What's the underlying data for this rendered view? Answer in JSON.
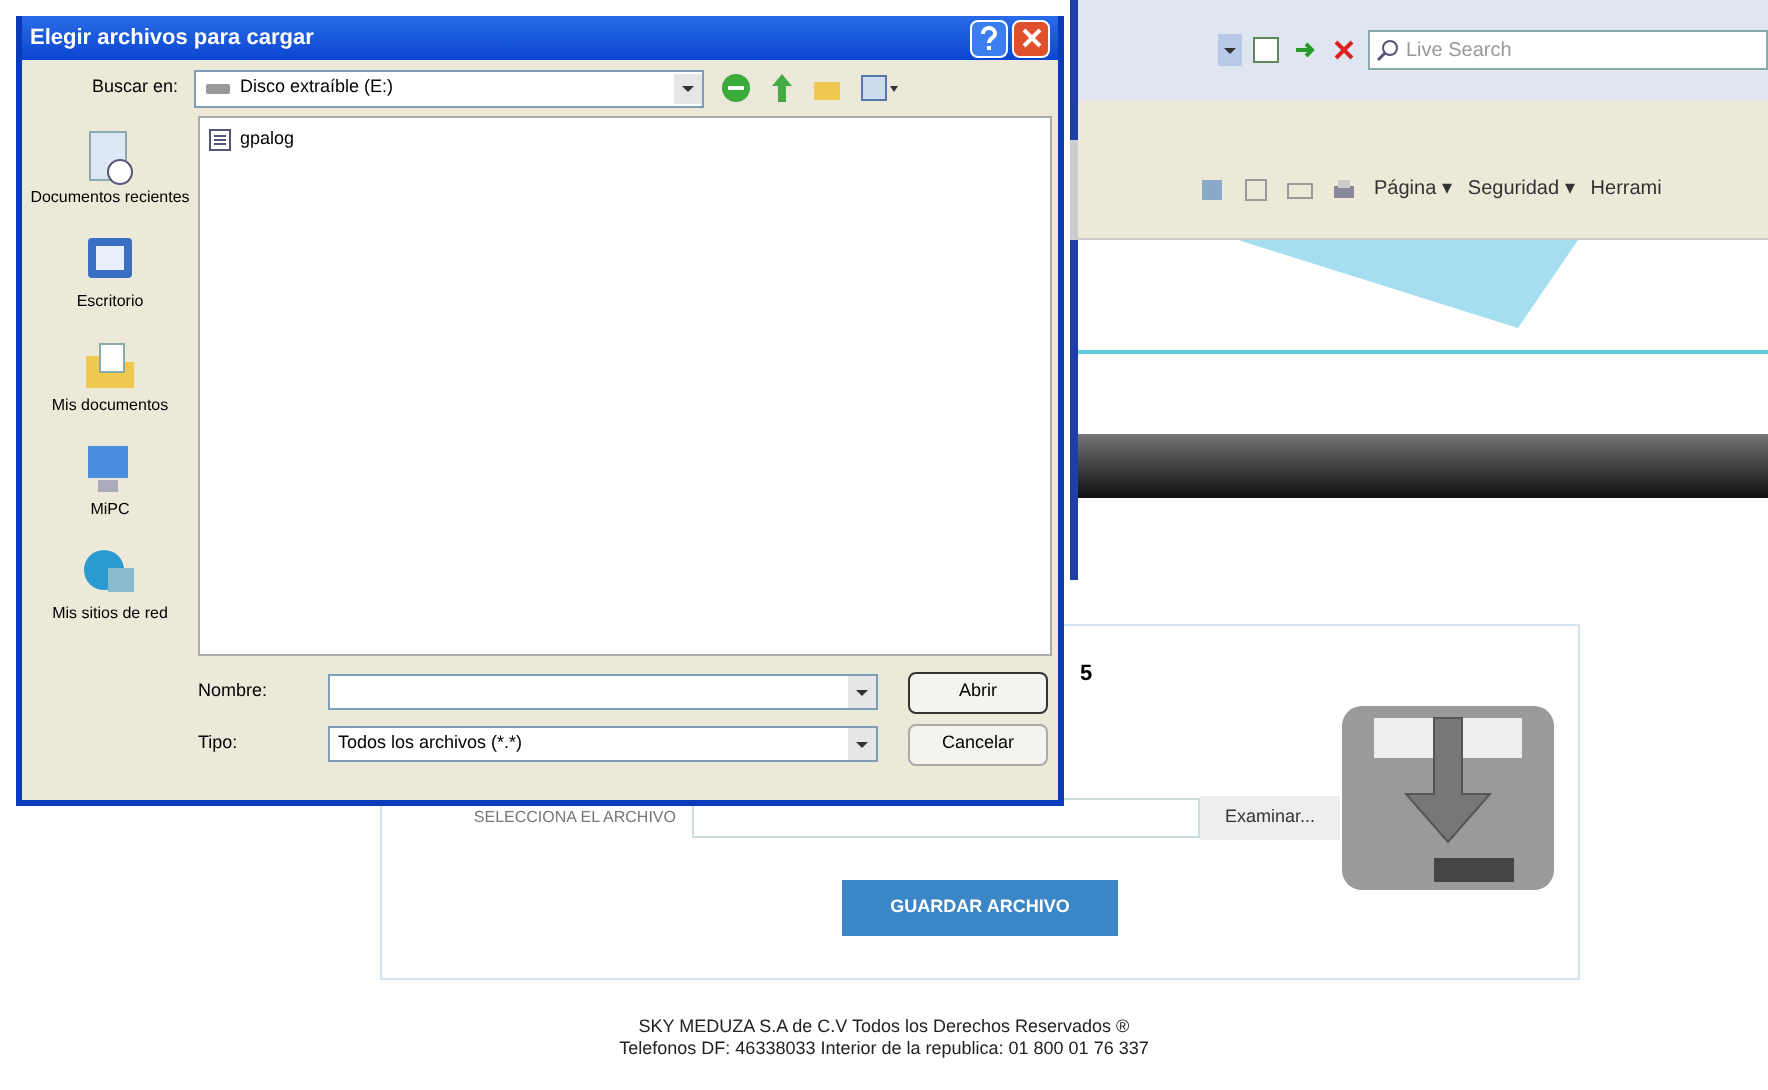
{
  "browser": {
    "search": {
      "placeholder": "Live Search"
    },
    "command_bar": [
      "Página ▾",
      "Seguridad ▾",
      "Herrami"
    ]
  },
  "upload_panel": {
    "title_fragment": "5",
    "file_label": "SELECCIONA EL ARCHIVO",
    "browse_button": "Examinar...",
    "save_button": "GUARDAR ARCHIVO"
  },
  "footer": [
    "SKY MEDUZA S.A de C.V Todos los Derechos Reservados ®",
    "Telefonos DF: 46338033 Interior de la republica: 01 800 01 76 337"
  ],
  "dialog": {
    "title": "Elegir archivos para cargar",
    "look_in_label": "Buscar en:",
    "look_in_value": "Disco extraíble (E:)",
    "places": [
      {
        "label": "Documentos recientes",
        "kind": "recent"
      },
      {
        "label": "Escritorio",
        "kind": "desktop"
      },
      {
        "label": "Mis documentos",
        "kind": "documents"
      },
      {
        "label": "MiPC",
        "kind": "computer"
      },
      {
        "label": "Mis sitios de red",
        "kind": "network"
      }
    ],
    "files": [
      {
        "name": "gpalog"
      }
    ],
    "name_label": "Nombre:",
    "type_label": "Tipo:",
    "type_value": "Todos los archivos (*.*)",
    "open_button": "Abrir",
    "cancel_button": "Cancelar"
  }
}
